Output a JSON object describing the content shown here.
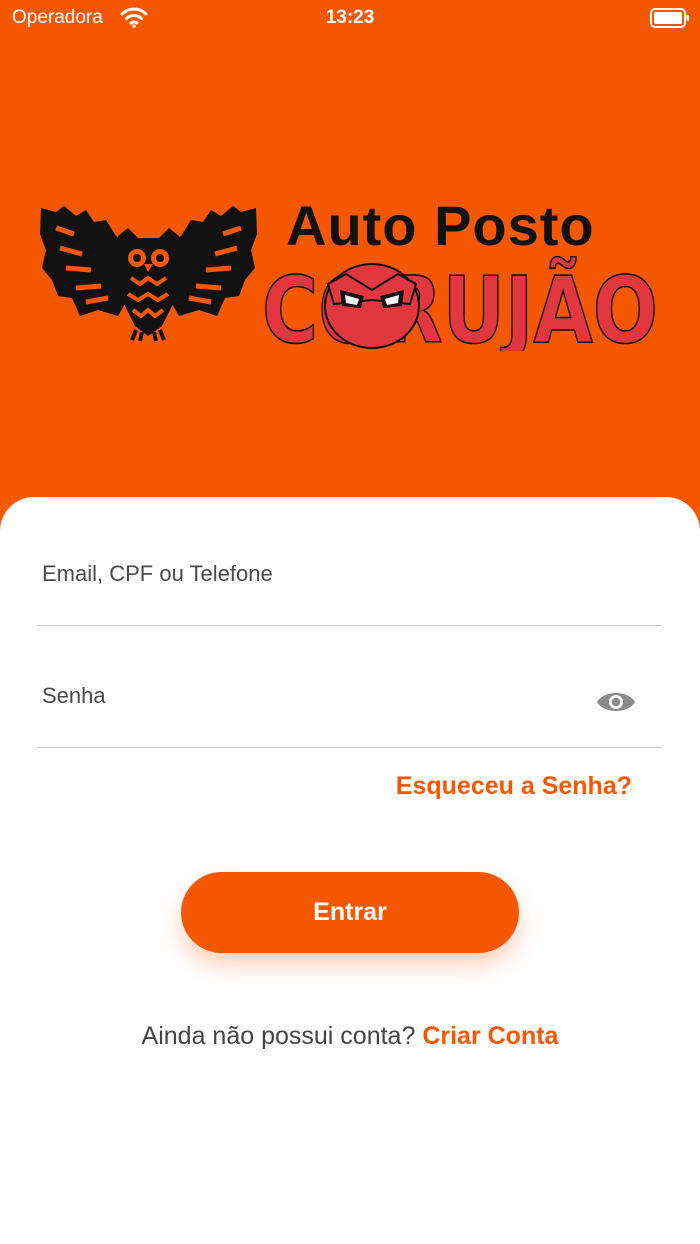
{
  "status_bar": {
    "carrier": "Operadora",
    "time": "13:23",
    "wifi_icon": "wifi-icon",
    "battery_icon": "battery-icon"
  },
  "logo": {
    "line1": "Auto Posto",
    "line2": "CORUJÃO",
    "icon": "owl-icon"
  },
  "form": {
    "email_placeholder": "Email, CPF ou Telefone",
    "email_value": "",
    "password_placeholder": "Senha",
    "password_value": "",
    "password_toggle_icon": "eye-icon",
    "forgot_password": "Esqueceu a Senha?",
    "login_button": "Entrar"
  },
  "signup": {
    "prompt": "Ainda não possui conta?",
    "link": "Criar Conta"
  },
  "colors": {
    "brand_orange": "#F55800",
    "logo_red": "#E0383E",
    "card_background": "#FFFFFF"
  }
}
